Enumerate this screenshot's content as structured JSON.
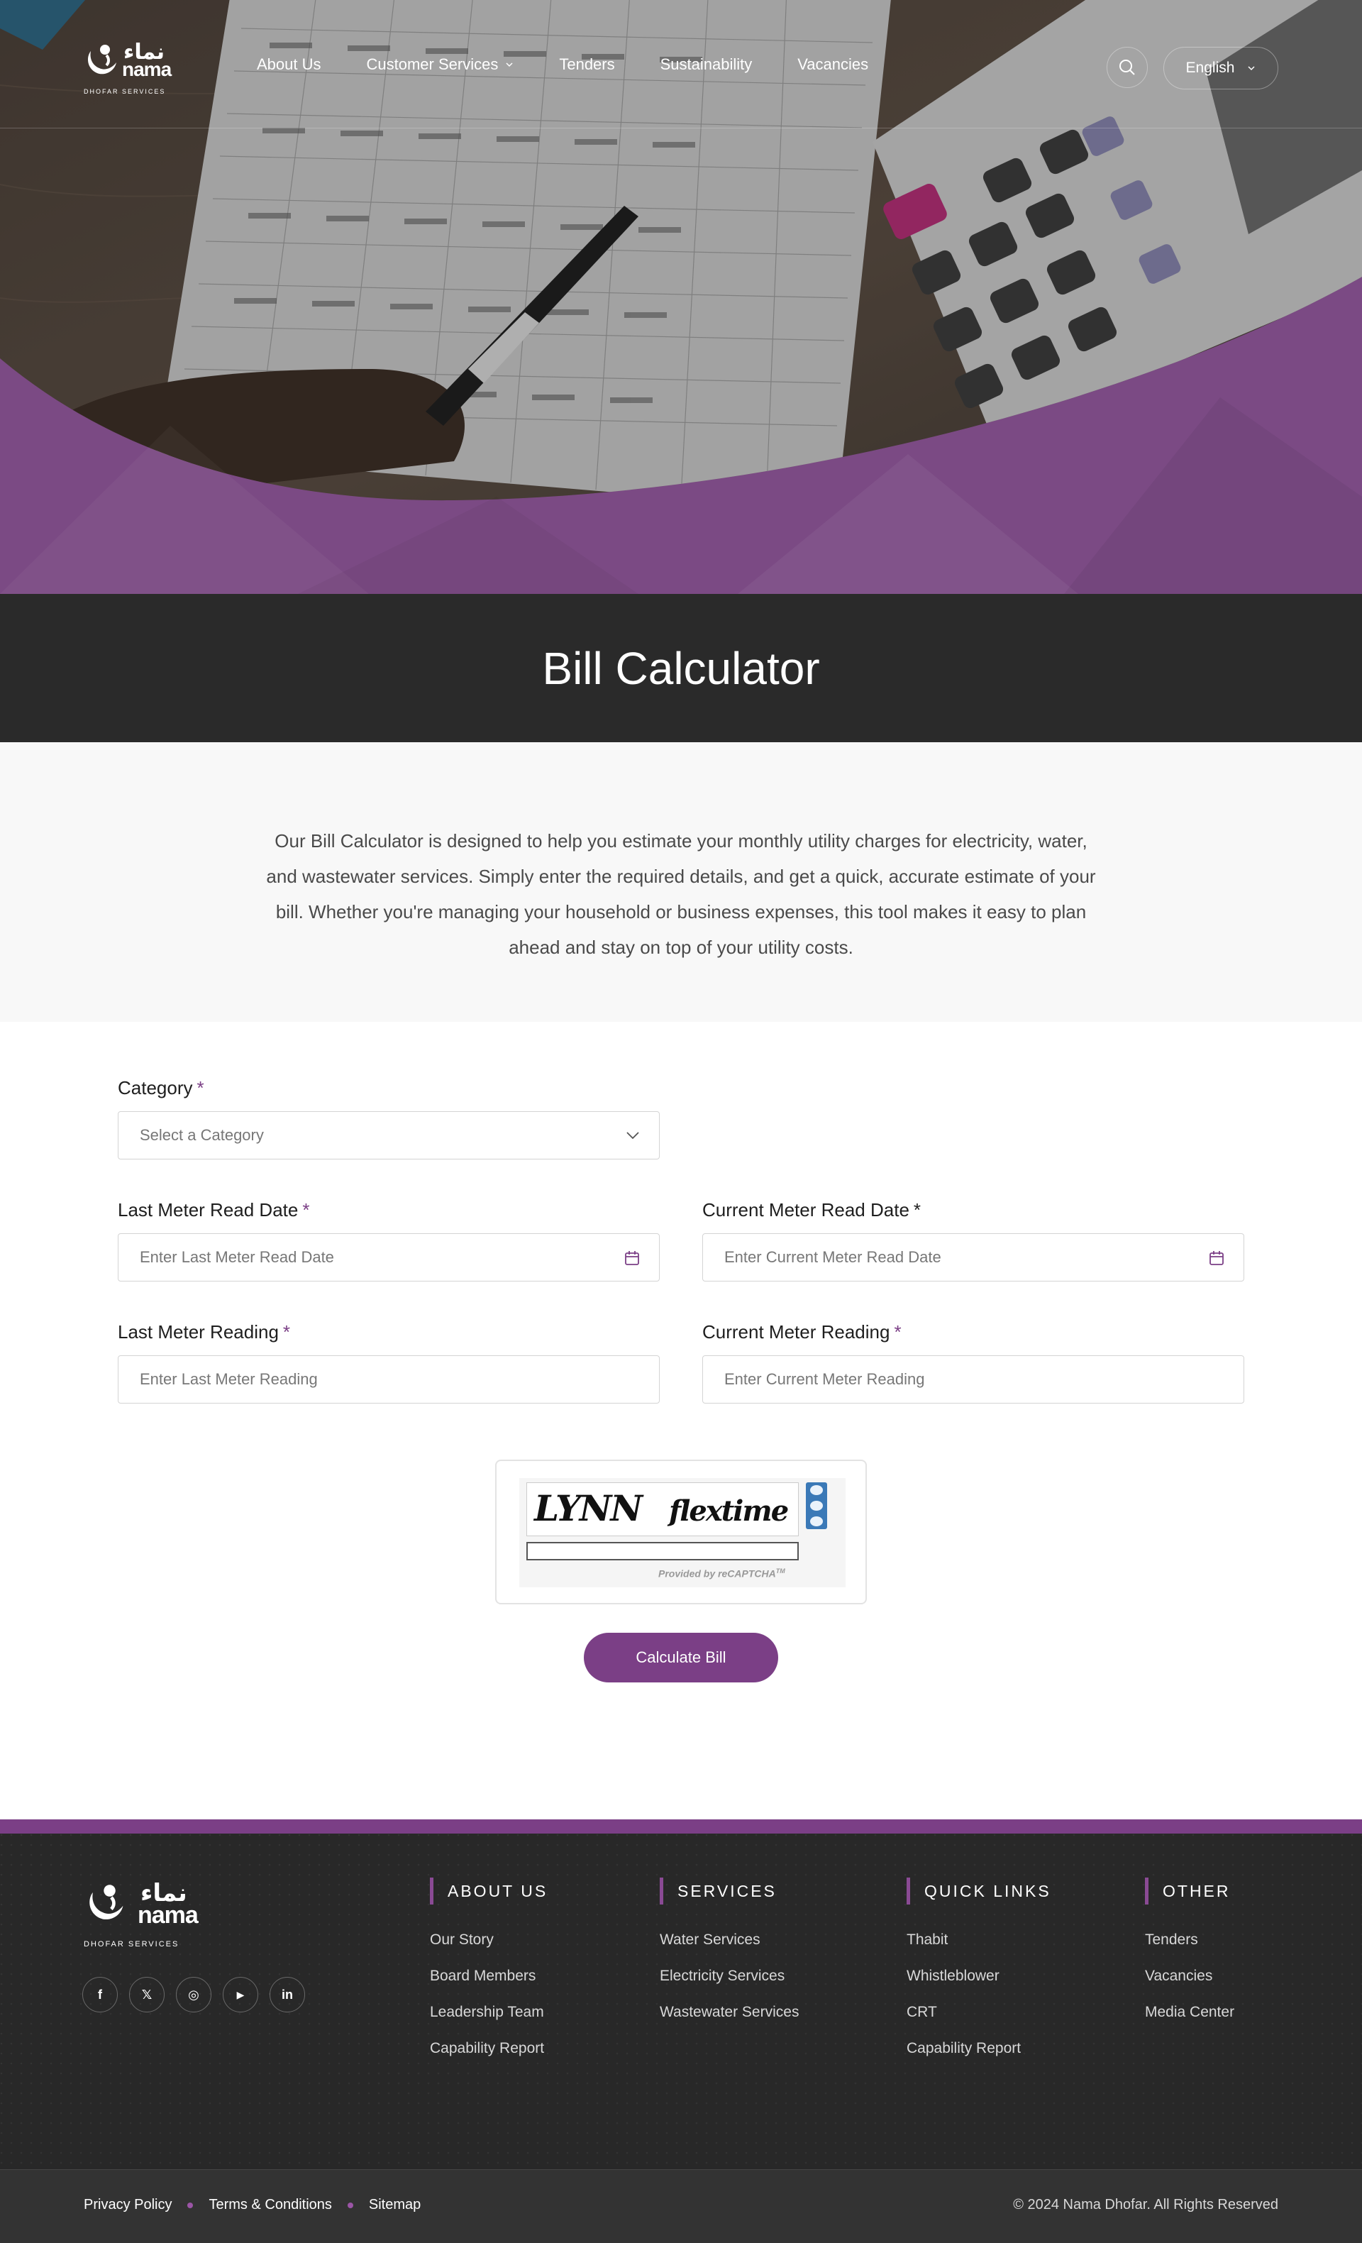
{
  "header": {
    "logo": {
      "arabic": "نماء",
      "english": "nama",
      "subtitle": "DHOFAR SERVICES"
    },
    "nav": [
      {
        "label": "About Us",
        "dropdown": false
      },
      {
        "label": "Customer Services",
        "dropdown": true
      },
      {
        "label": "Tenders",
        "dropdown": false
      },
      {
        "label": "Sustainability",
        "dropdown": false
      },
      {
        "label": "Vacancies",
        "dropdown": false
      }
    ],
    "search_icon": "search-icon",
    "language": "English"
  },
  "hero": {
    "background_image": "calculator-and-tax-table-photo"
  },
  "page": {
    "title": "Bill Calculator",
    "intro": "Our Bill Calculator is designed to help you estimate your monthly utility charges for electricity, water, and wastewater services. Simply enter the required details, and get a quick, accurate estimate of your bill. Whether you're managing your household or business expenses, this tool makes it easy to plan ahead and stay on top of your utility costs."
  },
  "form": {
    "category": {
      "label": "Category",
      "required": "*",
      "placeholder": "Select a Category"
    },
    "last_read_date": {
      "label": "Last Meter Read Date",
      "required": "*",
      "placeholder": "Enter Last Meter Read Date"
    },
    "current_read_date": {
      "label": "Current Meter Read Date",
      "required": "*",
      "placeholder": "Enter Current Meter Read Date"
    },
    "last_reading": {
      "label": "Last Meter Reading",
      "required": "*",
      "placeholder": "Enter Last Meter Reading"
    },
    "current_reading": {
      "label": "Current Meter Reading",
      "required": "*",
      "placeholder": "Enter Current Meter Reading"
    },
    "captcha": {
      "word1": "LYNN",
      "word2": "flextime",
      "provider": "Provided by reCAPTCHA",
      "tm": "TM"
    },
    "submit": "Calculate Bill"
  },
  "footer": {
    "logo": {
      "arabic": "نماء",
      "english": "nama",
      "subtitle": "DHOFAR SERVICES"
    },
    "social": [
      {
        "icon": "facebook-icon",
        "glyph": "f"
      },
      {
        "icon": "x-icon",
        "glyph": "𝕏"
      },
      {
        "icon": "instagram-icon",
        "glyph": "◎"
      },
      {
        "icon": "youtube-icon",
        "glyph": "▶"
      },
      {
        "icon": "linkedin-icon",
        "glyph": "in"
      }
    ],
    "columns": [
      {
        "heading": "ABOUT US",
        "items": [
          "Our Story",
          "Board Members",
          "Leadership Team",
          "Capability Report"
        ]
      },
      {
        "heading": "SERVICES",
        "items": [
          "Water Services",
          "Electricity Services",
          "Wastewater Services"
        ]
      },
      {
        "heading": "QUICK LINKS",
        "items": [
          "Thabit",
          "Whistleblower",
          "CRT",
          "Capability Report"
        ]
      },
      {
        "heading": "OTHER",
        "items": [
          "Tenders",
          "Vacancies",
          "Media Center"
        ]
      }
    ],
    "bottom_links": [
      "Privacy Policy",
      "Terms & Conditions",
      "Sitemap"
    ],
    "copyright": "© 2024 Nama Dhofar. All Rights Reserved"
  },
  "colors": {
    "accent": "#7b3f86",
    "hero_purple": "#7b4a84",
    "dark": "#2a2a2a",
    "footer": "#282828"
  }
}
